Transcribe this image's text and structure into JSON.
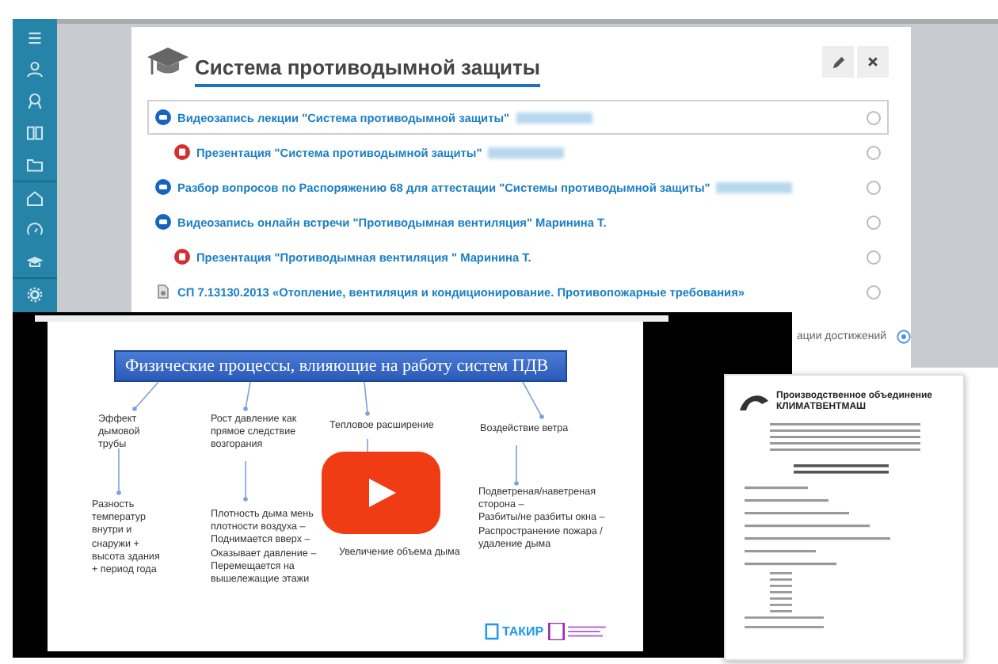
{
  "sidebar": {
    "items": [
      {
        "kind": "list"
      },
      {
        "kind": "user"
      },
      {
        "kind": "badge"
      },
      {
        "kind": "book"
      },
      {
        "kind": "folder"
      },
      {
        "kind": "home"
      },
      {
        "kind": "gauge"
      },
      {
        "kind": "cap"
      },
      {
        "kind": "gear"
      }
    ]
  },
  "modal": {
    "title": "Система противодымной защиты",
    "items": [
      {
        "kind": "video",
        "text": "Видеозапись лекции \"Система противодымной защиты\"",
        "blurred": true,
        "selected": true,
        "children": [
          {
            "kind": "presentation",
            "text": "Презентация \"Система противодымной защиты\"",
            "blurred": true,
            "selected": false
          }
        ]
      },
      {
        "kind": "video",
        "text": "Разбор вопросов по Распоряжению 68 для аттестации \"Системы противодымной защиты\"",
        "blurred": true,
        "selected": false
      },
      {
        "kind": "video",
        "text": "Видеозапись онлайн встречи \"Противодымная вентиляция\" Маринина Т.",
        "blurred": false,
        "selected": false,
        "children": [
          {
            "kind": "presentation",
            "text": "Презентация \"Противодымная вентиляция \" Маринина Т.",
            "blurred": false,
            "selected": false
          }
        ]
      },
      {
        "kind": "document",
        "text": "СП 7.13130.2013 «Отопление, вентиляция и кондиционирование. Противопожарные требования»",
        "blurred": false,
        "selected": false
      }
    ],
    "footer": "ации достижений"
  },
  "video": {
    "slide": {
      "title": "Физические процессы, влияющие на работу систем ПДВ",
      "columns": [
        {
          "heading": "Эффект дымовой трубы",
          "lines": [
            "Разность температур внутри и снаружи + высота здания + период года"
          ]
        },
        {
          "heading": "Рост давление как прямое следствие возгорания",
          "lines": [
            "Плотность дыма мень",
            "плотности воздуха –",
            "Поднимается вверх –",
            "Оказывает давление –",
            "Перемещается на вышележащие этажи"
          ]
        },
        {
          "heading": "Тепловое расширение",
          "lines": [
            "Увеличение объема дыма"
          ]
        },
        {
          "heading": "Воздействие ветра",
          "lines": [
            "Подветреная/наветреная сторона –",
            "Разбиты/не разбиты окна –",
            "Распространение пожара / удаление дыма"
          ]
        }
      ],
      "logo": "ТАКИР"
    }
  },
  "document": {
    "header": [
      "Производственное объединение",
      "КЛИМАТВЕНТМАШ"
    ]
  }
}
